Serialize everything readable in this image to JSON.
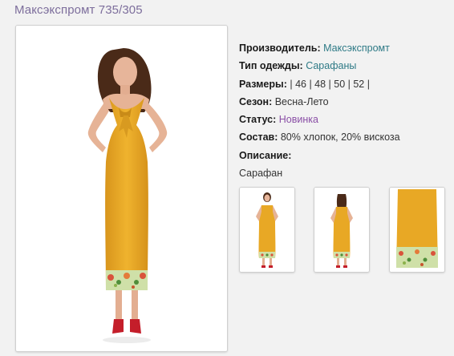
{
  "page": {
    "title": "Максэкспромт 735/305"
  },
  "details": {
    "manufacturer_label": "Производитель:",
    "manufacturer_value": "Максэкспромт",
    "type_label": "Тип одежды:",
    "type_value": "Сарафаны",
    "sizes_label": "Размеры:",
    "sizes_value": "| 46 | 48 | 50 | 52 |",
    "season_label": "Сезон:",
    "season_value": "Весна-Лето",
    "status_label": "Статус:",
    "status_value": "Новинка",
    "composition_label": "Состав:",
    "composition_value": "80% хлопок, 20% вискоза",
    "description_label": "Описание:",
    "description_value": "Сарафан"
  },
  "colors": {
    "title": "#7d6e9c",
    "link_teal": "#2e7a86",
    "link_purple": "#8a4fa6",
    "dress": "#e8a825",
    "shoes": "#c41e2a"
  },
  "images": {
    "main": "model-in-yellow-sundress-front",
    "thumbs": [
      "thumb-front-view",
      "thumb-back-view",
      "thumb-fabric-detail"
    ]
  }
}
